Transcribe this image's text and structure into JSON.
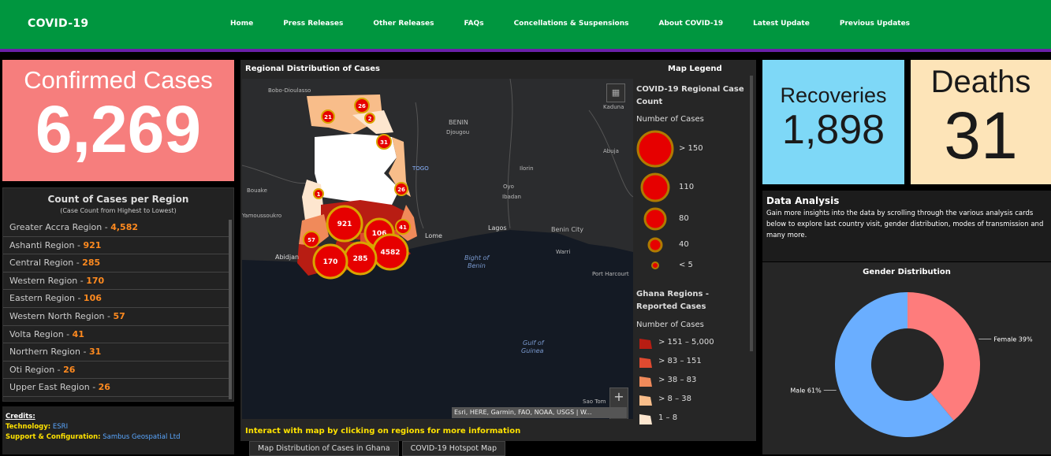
{
  "header": {
    "brand": "COVID-19",
    "nav": [
      "Home",
      "Press Releases",
      "Other Releases",
      "FAQs",
      "Concellations & Suspensions",
      "About COVID-19",
      "Latest Update",
      "Previous Updates"
    ],
    "bar_color": "#00963f",
    "stripe_color": "#6a1fa8"
  },
  "confirmed": {
    "label": "Confirmed Cases",
    "value": "6,269",
    "color": "#f67e7d"
  },
  "recoveries": {
    "label": "Recoveries",
    "value": "1,898",
    "color": "#7ed8f7"
  },
  "deaths": {
    "label": "Deaths",
    "value": "31",
    "color": "#fde4b8"
  },
  "regions": {
    "title": "Count of Cases per Region",
    "subtitle": "(Case Count from Highest to Lowest)",
    "items": [
      {
        "name": "Greater Accra Region - ",
        "value": "4,582"
      },
      {
        "name": "Ashanti Region - ",
        "value": "921"
      },
      {
        "name": "Central Region - ",
        "value": "285"
      },
      {
        "name": "Western Region - ",
        "value": "170"
      },
      {
        "name": "Eastern Region - ",
        "value": "106"
      },
      {
        "name": "Western North Region - ",
        "value": "57"
      },
      {
        "name": "Volta Region - ",
        "value": "41"
      },
      {
        "name": "Northern Region - ",
        "value": "31"
      },
      {
        "name": "Oti Region - ",
        "value": "26"
      },
      {
        "name": "Upper East Region - ",
        "value": "26"
      }
    ]
  },
  "credits": {
    "heading": "Credits:",
    "technology_label": "Technology:",
    "technology_value": "ESRI",
    "support_label": "Support & Configuration:",
    "support_value": "Sambus Geospatial Ltd"
  },
  "map": {
    "title": "Regional Distribution of Cases",
    "note": "Interact with map by clicking on regions for more information",
    "attribution": "Esri, HERE, Garmin, FAO, NOAA, USGS | W...",
    "zoom_in": "+",
    "zoom_out": "−",
    "places": [
      "Bobo-Dioulasso",
      "BENIN",
      "Djougou",
      "TOGO",
      "Kaduna",
      "Abuja",
      "Ilorin",
      "Oyo",
      "Ibadan",
      "Bouake",
      "Yamoussoukro",
      "Abidjan",
      "Lome",
      "Lagos",
      "Benin City",
      "Warri",
      "Port Harcourt",
      "Bight of",
      "Benin",
      "Gulf of",
      "Guinea",
      "Sao Tom"
    ],
    "clusters": [
      "921",
      "106",
      "4582",
      "285",
      "170",
      "57",
      "41",
      "26",
      "2",
      "21",
      "31",
      "26",
      "1"
    ],
    "icons": [
      "qr-code-icon"
    ]
  },
  "legend": {
    "title": "Map Legend",
    "layer1_title": "COVID-19 Regional Case Count",
    "layer1_sub": "Number of Cases",
    "circles": [
      "> 150",
      "110",
      "80",
      "40",
      "< 5"
    ],
    "layer2_title": "Ghana Regions - Reported Cases",
    "layer2_sub": "Number of Cases",
    "classes": [
      {
        "label": "> 151 – 5,000",
        "color": "#b81d13"
      },
      {
        "label": "> 83 – 151",
        "color": "#e04a30"
      },
      {
        "label": "> 38 – 83",
        "color": "#f08a5a"
      },
      {
        "label": "> 8 – 38",
        "color": "#f8bd8a"
      },
      {
        "label": "1 – 8",
        "color": "#fde6cf"
      }
    ]
  },
  "tabs": [
    "Map Distribution of Cases in Ghana",
    "COVID-19 Hotspot Map"
  ],
  "analysis": {
    "title": "Data Analysis",
    "description": "Gain more insights into the data by scrolling through the various analysis cards below to explore last country visit, gender distribution, modes of transmission and many more."
  },
  "gender": {
    "title": "Gender Distribution",
    "chart_data": {
      "type": "pie",
      "categories": [
        "Female",
        "Male"
      ],
      "values": [
        39,
        61
      ],
      "labels": [
        "Female 39%",
        "Male 61%"
      ],
      "colors": [
        "#fe7c7c",
        "#6aaeff"
      ]
    }
  }
}
